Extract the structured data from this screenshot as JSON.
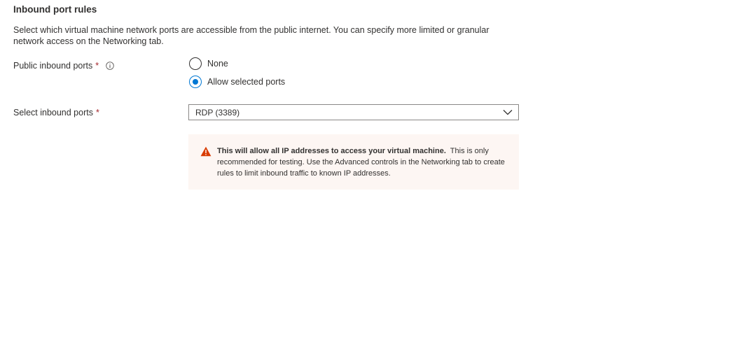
{
  "section": {
    "title": "Inbound port rules",
    "description": "Select which virtual machine network ports are accessible from the public internet. You can specify more limited or granular network access on the Networking tab."
  },
  "public_ports": {
    "label": "Public inbound ports",
    "required_mark": "*",
    "info_icon": "info-icon",
    "options": [
      {
        "label": "None",
        "selected": false
      },
      {
        "label": "Allow selected ports",
        "selected": true
      }
    ]
  },
  "select_ports": {
    "label": "Select inbound ports",
    "required_mark": "*",
    "value": "RDP (3389)",
    "chevron_icon": "chevron-down-icon"
  },
  "warning": {
    "icon": "warning-icon",
    "bold_text": "This will allow all IP addresses to access your virtual machine.",
    "text": "This is only recommended for testing.  Use the Advanced controls in the Networking tab to create rules to limit inbound traffic to known IP addresses."
  },
  "colors": {
    "accent": "#0078d4",
    "required": "#a4262c",
    "warning_icon": "#d83b01",
    "warning_bg": "#fdf6f3"
  }
}
